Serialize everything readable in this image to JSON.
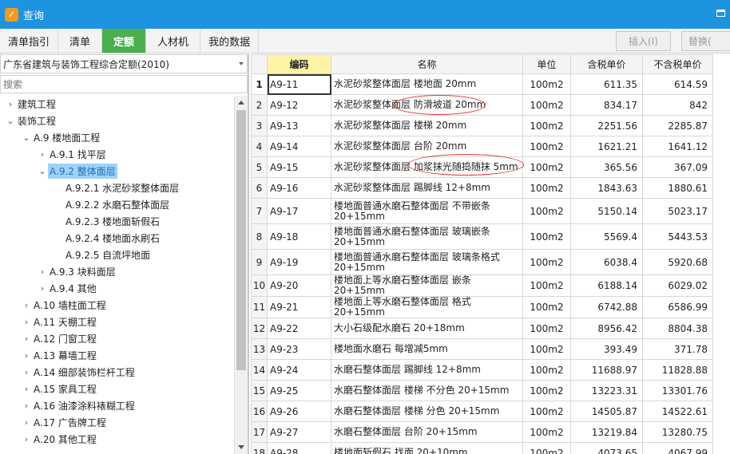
{
  "window": {
    "title": "查询",
    "icon": "app-search-icon"
  },
  "tabs": [
    {
      "label": "清单指引",
      "active": false
    },
    {
      "label": "清单",
      "active": false
    },
    {
      "label": "定额",
      "active": true
    },
    {
      "label": "人材机",
      "active": false
    },
    {
      "label": "我的数据",
      "active": false
    }
  ],
  "toolbar": {
    "insert_label": "插入(I)",
    "replace_label": "替换("
  },
  "library": {
    "selected": "广东省建筑与装饰工程综合定额(2010)"
  },
  "search": {
    "placeholder": "搜索"
  },
  "tree": [
    {
      "label": "建筑工程",
      "level": 0,
      "state": "collapsed"
    },
    {
      "label": "装饰工程",
      "level": 0,
      "state": "expanded"
    },
    {
      "label": "A.9 楼地面工程",
      "level": 1,
      "state": "expanded"
    },
    {
      "label": "A.9.1 找平层",
      "level": 2,
      "state": "collapsed"
    },
    {
      "label": "A.9.2 整体面层",
      "level": 2,
      "state": "expanded",
      "selected": true
    },
    {
      "label": "A.9.2.1 水泥砂浆整体面层",
      "level": 3,
      "state": "leaf"
    },
    {
      "label": "A.9.2.2 水磨石整体面层",
      "level": 3,
      "state": "leaf"
    },
    {
      "label": "A.9.2.3 楼地面斩假石",
      "level": 3,
      "state": "leaf"
    },
    {
      "label": "A.9.2.4 楼地面水刷石",
      "level": 3,
      "state": "leaf"
    },
    {
      "label": "A.9.2.5 自流坪地面",
      "level": 3,
      "state": "leaf"
    },
    {
      "label": "A.9.3 块料面层",
      "level": 2,
      "state": "collapsed"
    },
    {
      "label": "A.9.4 其他",
      "level": 2,
      "state": "collapsed"
    },
    {
      "label": "A.10 墙柱面工程",
      "level": 1,
      "state": "collapsed"
    },
    {
      "label": "A.11 天棚工程",
      "level": 1,
      "state": "collapsed"
    },
    {
      "label": "A.12 门窗工程",
      "level": 1,
      "state": "collapsed"
    },
    {
      "label": "A.13 幕墙工程",
      "level": 1,
      "state": "collapsed"
    },
    {
      "label": "A.14 细部装饰栏杆工程",
      "level": 1,
      "state": "collapsed"
    },
    {
      "label": "A.15 家具工程",
      "level": 1,
      "state": "collapsed"
    },
    {
      "label": "A.16 油漆涂料裱糊工程",
      "level": 1,
      "state": "collapsed"
    },
    {
      "label": "A.17 广告牌工程",
      "level": 1,
      "state": "collapsed"
    },
    {
      "label": "A.20 其他工程",
      "level": 1,
      "state": "collapsed"
    }
  ],
  "table": {
    "headers": [
      "",
      "编码",
      "名称",
      "单位",
      "含税单价",
      "不含税单价"
    ],
    "rows": [
      {
        "no": "1",
        "code": "A9-11",
        "name": "水泥砂浆整体面层 楼地面 20mm",
        "unit": "100m2",
        "tax": "611.35",
        "notax": "614.59"
      },
      {
        "no": "2",
        "code": "A9-12",
        "name": "水泥砂浆整体面层 防滑坡道 20mm",
        "unit": "100m2",
        "tax": "834.17",
        "notax": "842"
      },
      {
        "no": "3",
        "code": "A9-13",
        "name": "水泥砂浆整体面层 楼梯 20mm",
        "unit": "100m2",
        "tax": "2251.56",
        "notax": "2285.87"
      },
      {
        "no": "4",
        "code": "A9-14",
        "name": "水泥砂浆整体面层 台阶 20mm",
        "unit": "100m2",
        "tax": "1621.21",
        "notax": "1641.12"
      },
      {
        "no": "5",
        "code": "A9-15",
        "name": "水泥砂浆整体面层 加浆抹光随捣随抹 5mm",
        "unit": "100m2",
        "tax": "365.56",
        "notax": "367.09"
      },
      {
        "no": "6",
        "code": "A9-16",
        "name": "水泥砂浆整体面层 踢脚线 12+8mm",
        "unit": "100m2",
        "tax": "1843.63",
        "notax": "1880.61"
      },
      {
        "no": "7",
        "code": "A9-17",
        "name": "楼地面普通水磨石整体面层 不带嵌条 20+15mm",
        "unit": "100m2",
        "tax": "5150.14",
        "notax": "5023.17"
      },
      {
        "no": "8",
        "code": "A9-18",
        "name": "楼地面普通水磨石整体面层 玻璃嵌条 20+15mm",
        "unit": "100m2",
        "tax": "5569.4",
        "notax": "5443.53"
      },
      {
        "no": "9",
        "code": "A9-19",
        "name": "楼地面普通水磨石整体面层 玻璃条格式 20+15mm",
        "unit": "100m2",
        "tax": "6038.4",
        "notax": "5920.68"
      },
      {
        "no": "10",
        "code": "A9-20",
        "name": "楼地面上等水磨石整体面层 嵌条 20+15mm",
        "unit": "100m2",
        "tax": "6188.14",
        "notax": "6029.02"
      },
      {
        "no": "11",
        "code": "A9-21",
        "name": "楼地面上等水磨石整体面层 格式 20+15mm",
        "unit": "100m2",
        "tax": "6742.88",
        "notax": "6586.99"
      },
      {
        "no": "12",
        "code": "A9-22",
        "name": "大小石级配水磨石 20+18mm",
        "unit": "100m2",
        "tax": "8956.42",
        "notax": "8804.38"
      },
      {
        "no": "13",
        "code": "A9-23",
        "name": "楼地面水磨石 每增减5mm",
        "unit": "100m2",
        "tax": "393.49",
        "notax": "371.78"
      },
      {
        "no": "14",
        "code": "A9-24",
        "name": "水磨石整体面层 踢脚线 12+8mm",
        "unit": "100m2",
        "tax": "11688.97",
        "notax": "11828.88"
      },
      {
        "no": "15",
        "code": "A9-25",
        "name": "水磨石整体面层 楼梯 不分色 20+15mm",
        "unit": "100m2",
        "tax": "13223.31",
        "notax": "13301.76"
      },
      {
        "no": "16",
        "code": "A9-26",
        "name": "水磨石整体面层 楼梯 分色 20+15mm",
        "unit": "100m2",
        "tax": "14505.87",
        "notax": "14522.61"
      },
      {
        "no": "17",
        "code": "A9-27",
        "name": "水磨石整体面层 台阶 20+15mm",
        "unit": "100m2",
        "tax": "13219.84",
        "notax": "13280.75"
      },
      {
        "no": "18",
        "code": "A9-28",
        "name": "楼地面斩假石 找面 20+10mm",
        "unit": "100m2",
        "tax": "4073.65",
        "notax": "4067.99"
      }
    ]
  }
}
